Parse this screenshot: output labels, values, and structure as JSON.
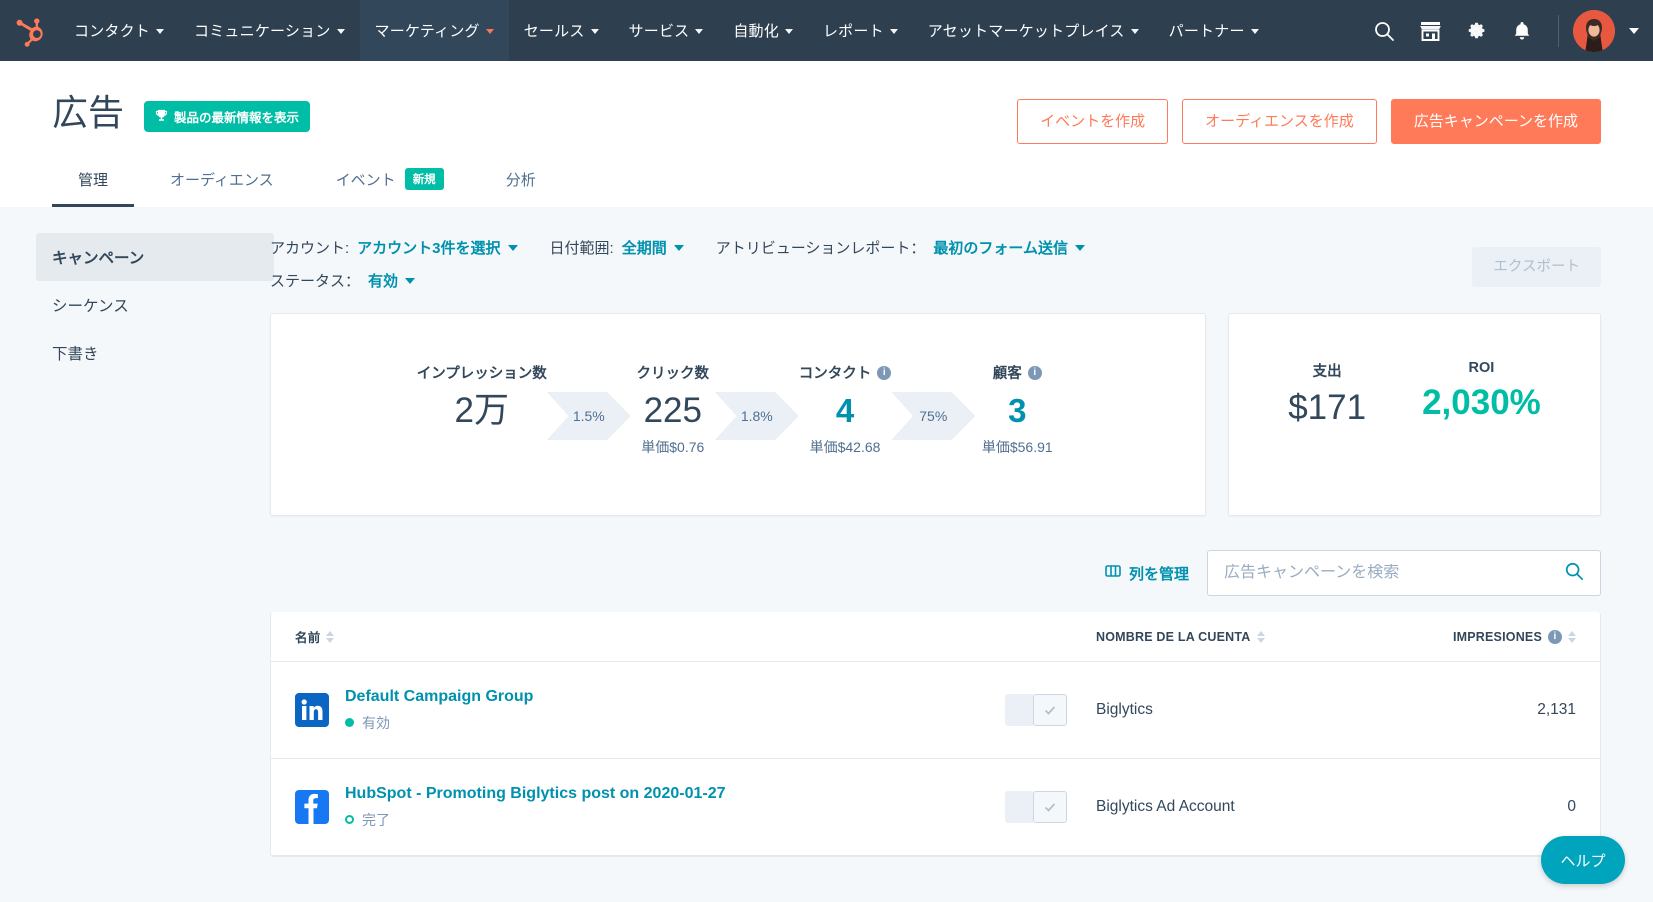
{
  "topnav": {
    "logo_name": "hubspot-logo",
    "items": [
      {
        "label": "コンタクト",
        "caret": true,
        "active": false
      },
      {
        "label": "コミュニケーション",
        "caret": true,
        "active": false
      },
      {
        "label": "マーケティング",
        "caret": true,
        "active": true
      },
      {
        "label": "セールス",
        "caret": true,
        "active": false
      },
      {
        "label": "サービス",
        "caret": true,
        "active": false
      },
      {
        "label": "自動化",
        "caret": true,
        "active": false
      },
      {
        "label": "レポート",
        "caret": true,
        "active": false
      },
      {
        "label": "アセットマーケットプレイス",
        "caret": true,
        "active": false
      },
      {
        "label": "パートナー",
        "caret": true,
        "active": false
      }
    ],
    "icons": [
      "search-icon",
      "marketplace-icon",
      "settings-gear-icon",
      "notifications-bell-icon"
    ],
    "background": "#2e3f50",
    "active_background": "#33475b"
  },
  "header": {
    "title": "広告",
    "badge": "製品の最新情報を表示",
    "badge_icon": "trophy-icon",
    "badge_color": "#00bda5",
    "actions": [
      {
        "label": "イベントを作成",
        "style": "secondary"
      },
      {
        "label": "オーディエンスを作成",
        "style": "secondary"
      },
      {
        "label": "広告キャンペーンを作成",
        "style": "primary"
      }
    ],
    "primary_color": "#ff7a59",
    "tabs": [
      {
        "label": "管理",
        "active": true,
        "badge": null
      },
      {
        "label": "オーディエンス",
        "active": false,
        "badge": null
      },
      {
        "label": "イベント",
        "active": false,
        "badge": "新規"
      },
      {
        "label": "分析",
        "active": false,
        "badge": null
      }
    ]
  },
  "sidebar": {
    "items": [
      {
        "label": "キャンペーン",
        "active": true
      },
      {
        "label": "シーケンス",
        "active": false
      },
      {
        "label": "下書き",
        "active": false
      }
    ]
  },
  "filters": {
    "row1": [
      {
        "label": "アカウント:",
        "value": "アカウント3件を選択"
      },
      {
        "label": "日付範囲:",
        "value": "全期間"
      },
      {
        "label": "アトリビューションレポート：",
        "value": "最初のフォーム送信"
      }
    ],
    "row2": [
      {
        "label": "ステータス：",
        "value": "有効"
      }
    ],
    "export_label": "エクスポート"
  },
  "funnel": {
    "steps": [
      {
        "label": "インプレッション数",
        "value": "2万",
        "sub": null,
        "link": false,
        "info": false
      },
      {
        "label": "クリック数",
        "value": "225",
        "sub": "単価$0.76",
        "link": false,
        "info": false
      },
      {
        "label": "コンタクト",
        "value": "4",
        "sub": "単価$42.68",
        "link": true,
        "info": true
      },
      {
        "label": "顧客",
        "value": "3",
        "sub": "単価$56.91",
        "link": true,
        "info": true
      }
    ],
    "conversions": [
      "1.5%",
      "1.8%",
      "75%"
    ]
  },
  "roi": {
    "spend_label": "支出",
    "spend_value": "$171",
    "roi_label": "ROI",
    "roi_value": "2,030%",
    "roi_color": "#00bda5"
  },
  "table_toolbar": {
    "manage_columns": "列を管理",
    "manage_columns_icon": "columns-icon",
    "search_placeholder": "広告キャンペーンを検索",
    "search_value": "",
    "search_icon": "search-icon"
  },
  "table": {
    "columns": [
      {
        "label": "名前",
        "sortable": true,
        "info": false
      },
      {
        "label": "NOMBRE DE LA CUENTA",
        "sortable": true,
        "info": false
      },
      {
        "label": "IMPRESIONES",
        "sortable": true,
        "info": true
      }
    ],
    "rows": [
      {
        "network": "linkedin",
        "name": "Default Campaign Group",
        "status": "有効",
        "status_state": "on",
        "toggle_on": false,
        "account": "Biglytics",
        "impressions": "2,131"
      },
      {
        "network": "facebook",
        "name": "HubSpot - Promoting Biglytics post on 2020-01-27",
        "status": "完了",
        "status_state": "off",
        "toggle_on": false,
        "account": "Biglytics Ad Account",
        "impressions": "0"
      }
    ]
  },
  "help": {
    "label": "ヘルプ",
    "color": "#00a4bd"
  }
}
